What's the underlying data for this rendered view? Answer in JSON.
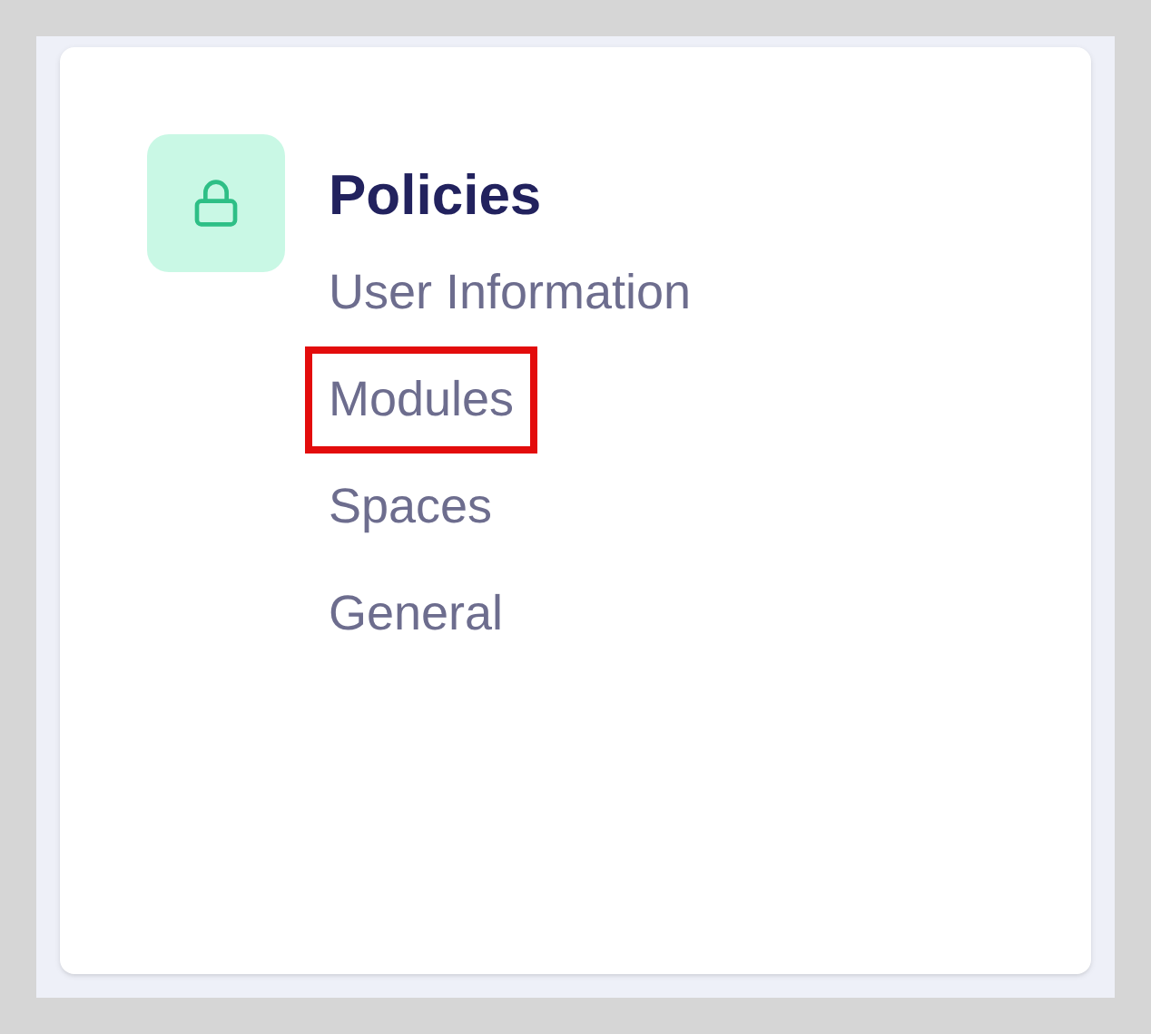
{
  "section": {
    "title": "Policies",
    "links": [
      {
        "label": "User Information",
        "highlighted": false
      },
      {
        "label": "Modules",
        "highlighted": true
      },
      {
        "label": "Spaces",
        "highlighted": false
      },
      {
        "label": "General",
        "highlighted": false
      }
    ]
  }
}
